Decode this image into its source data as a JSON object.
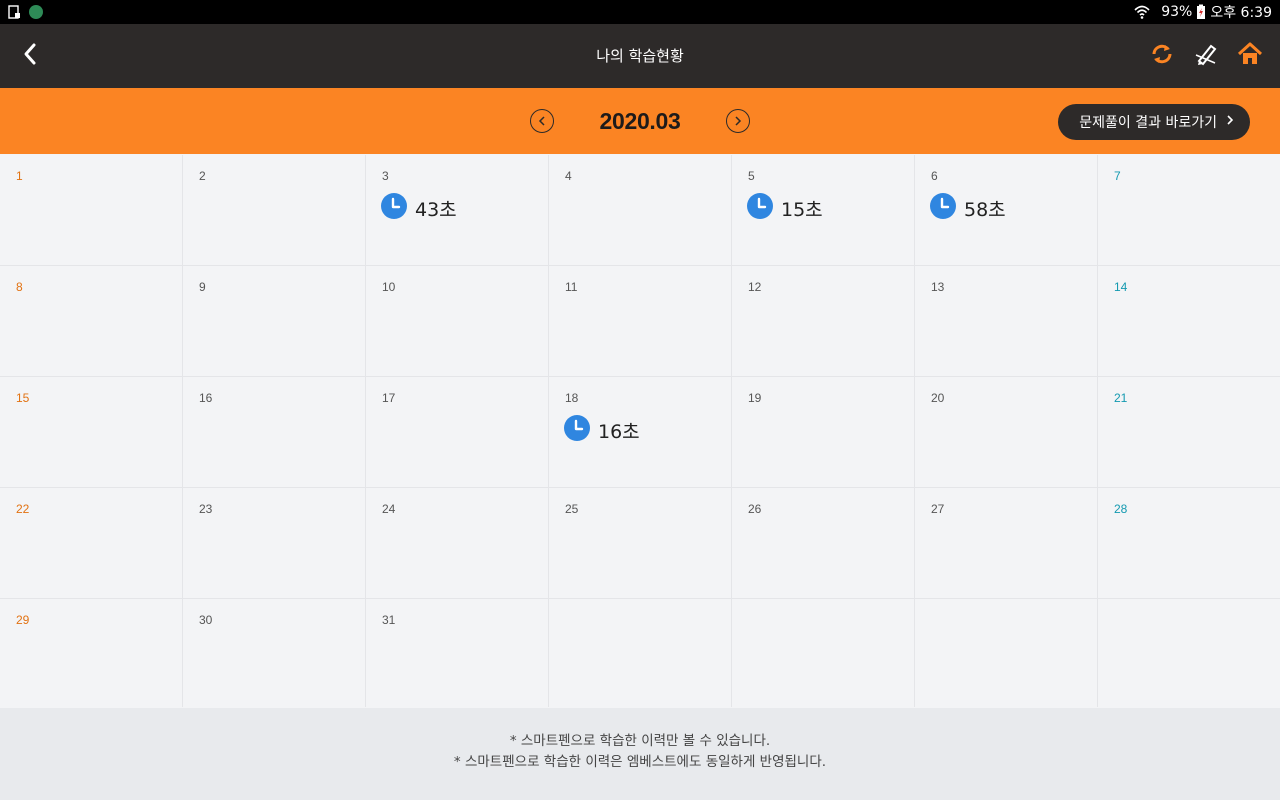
{
  "status_bar": {
    "battery": "93%",
    "time": "오후 6:39",
    "icons": [
      "screenshot-icon",
      "app-notification-icon",
      "wifi-icon",
      "battery-icon"
    ]
  },
  "app_bar": {
    "title": "나의 학습현황",
    "icons": [
      "back-icon",
      "refresh-icon",
      "pen-icon",
      "home-icon"
    ]
  },
  "month_bar": {
    "month": "2020.03",
    "result_button": "문제풀이 결과 바로가기"
  },
  "colors": {
    "accent": "#fb8423",
    "dark": "#2d2a29",
    "sunday": "#e27212",
    "saturday": "#1399b0",
    "clock": "#2f86e0"
  },
  "calendar": {
    "weeks": [
      [
        {
          "day": "1",
          "type": "sun"
        },
        {
          "day": "2"
        },
        {
          "day": "3",
          "study": "43초"
        },
        {
          "day": "4"
        },
        {
          "day": "5",
          "study": "15초"
        },
        {
          "day": "6",
          "study": "58초"
        },
        {
          "day": "7",
          "type": "sat"
        }
      ],
      [
        {
          "day": "8",
          "type": "sun"
        },
        {
          "day": "9"
        },
        {
          "day": "10"
        },
        {
          "day": "11"
        },
        {
          "day": "12"
        },
        {
          "day": "13"
        },
        {
          "day": "14",
          "type": "sat"
        }
      ],
      [
        {
          "day": "15",
          "type": "sun"
        },
        {
          "day": "16"
        },
        {
          "day": "17"
        },
        {
          "day": "18",
          "study": "16초"
        },
        {
          "day": "19"
        },
        {
          "day": "20"
        },
        {
          "day": "21",
          "type": "sat"
        }
      ],
      [
        {
          "day": "22",
          "type": "sun"
        },
        {
          "day": "23"
        },
        {
          "day": "24"
        },
        {
          "day": "25"
        },
        {
          "day": "26"
        },
        {
          "day": "27"
        },
        {
          "day": "28",
          "type": "sat"
        }
      ],
      [
        {
          "day": "29",
          "type": "sun"
        },
        {
          "day": "30"
        },
        {
          "day": "31"
        },
        {
          "day": ""
        },
        {
          "day": ""
        },
        {
          "day": ""
        },
        {
          "day": ""
        }
      ]
    ]
  },
  "footer": {
    "note1": "* 스마트펜으로 학습한 이력만 볼 수 있습니다.",
    "note2": "* 스마트펜으로 학습한 이력은 엠베스트에도 동일하게 반영됩니다."
  }
}
